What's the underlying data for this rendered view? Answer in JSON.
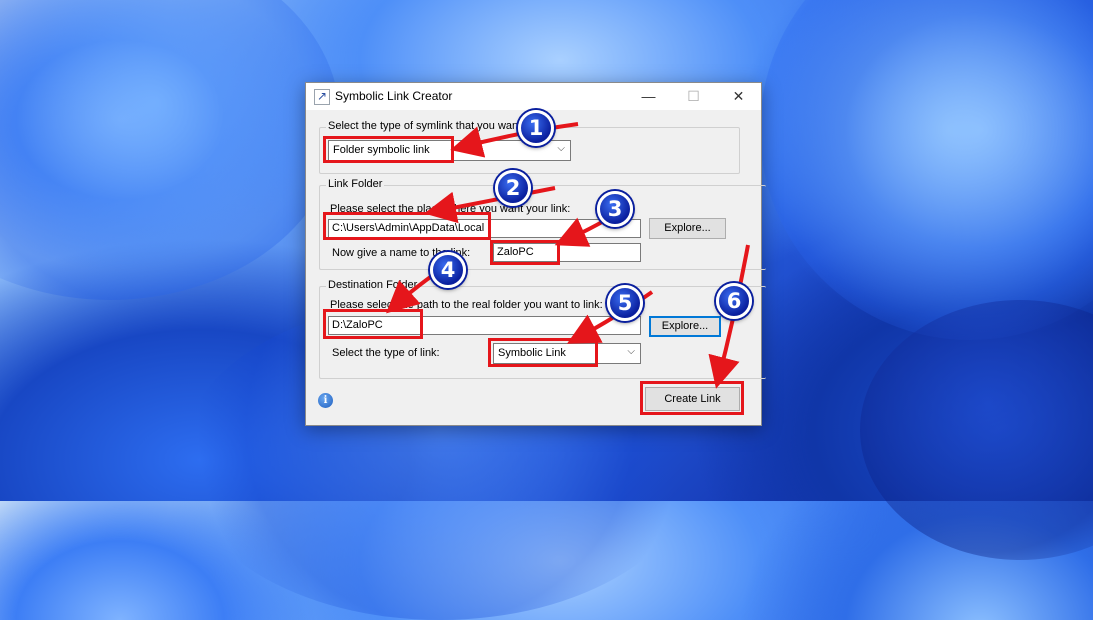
{
  "window": {
    "title": "Symbolic Link Creator",
    "controls": {
      "minimize": "—",
      "maximize": "☐",
      "close": "✕"
    }
  },
  "symlink_type": {
    "group_label": "Select the type of symlink that you want",
    "selected": "Folder symbolic link"
  },
  "link_folder": {
    "legend": "Link Folder",
    "prompt": "Please select the place where you want your link:",
    "path_value": "C:\\Users\\Admin\\AppData\\Local",
    "explore_label": "Explore...",
    "name_prompt": "Now give a name to the link:",
    "name_value": "ZaloPC"
  },
  "destination_folder": {
    "legend": "Destination Folder",
    "prompt": "Please select the path to the real folder you want to link:",
    "path_value": "D:\\ZaloPC",
    "explore_label": "Explore...",
    "link_type_label": "Select the type of link:",
    "link_type_selected": "Symbolic Link"
  },
  "create_button_label": "Create Link",
  "info_icon_glyph": "i",
  "annotations": {
    "steps": [
      "1",
      "2",
      "3",
      "4",
      "5",
      "6"
    ],
    "highlight_color": "#e5161b",
    "badge_color": "#0a1f9e"
  }
}
